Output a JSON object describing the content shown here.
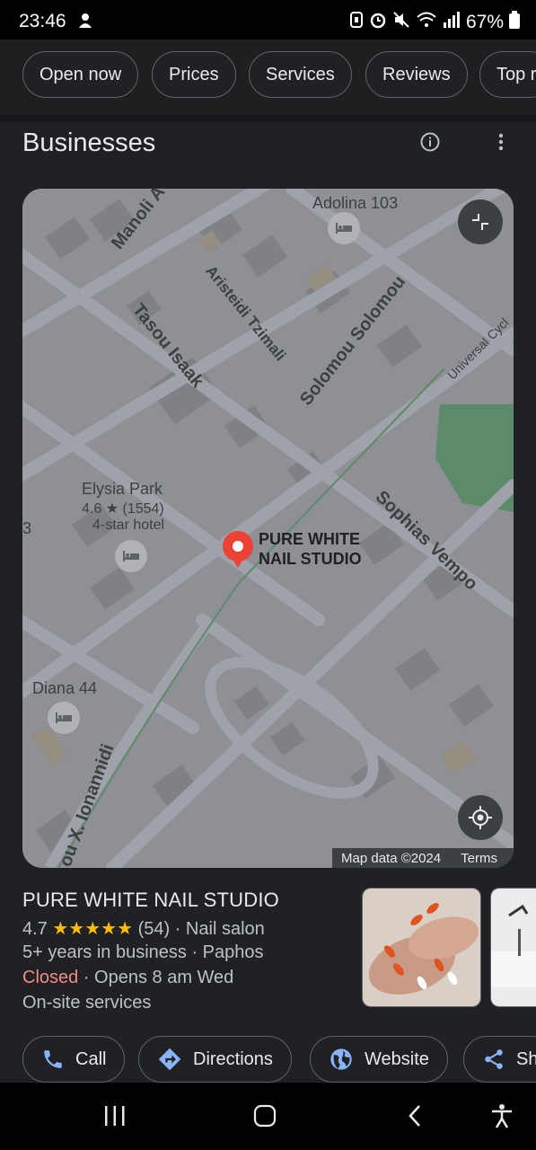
{
  "status_bar": {
    "time": "23:46",
    "battery": "67%"
  },
  "chips": [
    "Open now",
    "Prices",
    "Services",
    "Reviews",
    "Top r"
  ],
  "section": {
    "title": "Businesses"
  },
  "map": {
    "places": [
      {
        "name": "Adolina 103"
      },
      {
        "name": "Elysia Park",
        "rating": "4.6 ★ (1554)",
        "type": "4-star hotel"
      },
      {
        "name": "Diana 44"
      },
      {
        "name": "PURE WHITE",
        "name2": "NAIL STUDIO"
      }
    ],
    "streets": [
      "Manoli A",
      "Aristeidi Tzimali",
      "Tasou Isaak",
      "Solomou Solomou",
      "Universal Cycl",
      "Sophias Vempo",
      "ou X. Ionannidi"
    ],
    "edge_label": "3",
    "footer": {
      "data": "Map data ©2024",
      "terms": "Terms"
    }
  },
  "business": {
    "name": "PURE WHITE NAIL STUDIO",
    "rating": "4.7",
    "stars": "★★★★★",
    "reviews": "(54) · Nail salon",
    "years": "5+ years in business · Paphos",
    "status": "Closed",
    "opens": " · Opens 8 am Wed",
    "services": "On-site services"
  },
  "actions": [
    "Call",
    "Directions",
    "Website",
    "Sh"
  ],
  "colors": {
    "accent": "#8ab4f8",
    "closed": "#f28b82",
    "star": "#fbbc04",
    "pin": "#ea4335"
  }
}
